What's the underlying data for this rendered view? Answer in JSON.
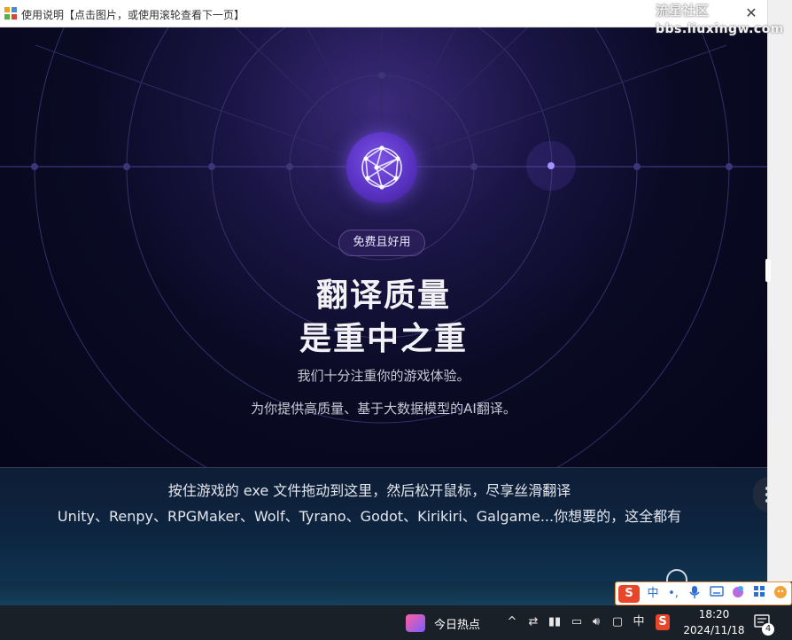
{
  "window": {
    "title": "使用说明【点击图片，或使用滚轮查看下一页】",
    "close_label": "✕"
  },
  "watermark": {
    "line1": "流星社区",
    "line2": "bbs.liuxingw.com"
  },
  "hero": {
    "badge": "免费且好用",
    "headline_1": "翻译质量",
    "headline_2": "是重中之重",
    "sub_1": "我们十分注重你的游戏体验。",
    "sub_2": "为你提供高质量、基于大数据模型的AI翻译。"
  },
  "dropzone": {
    "instruction": "按住游戏的 exe 文件拖动到这里，然后松开鼠标，尽享丝滑翻译",
    "engines": "Unity、Renpy、RPGMaker、Wolf、Tyrano、Godot、Kirikiri、Galgame...你想要的，这全都有"
  },
  "ime": {
    "logo": "S",
    "mode": "中",
    "punct": "•,",
    "icons": [
      "mic-icon",
      "keyboard-icon",
      "skin-icon",
      "apps-icon",
      "avatar-icon"
    ]
  },
  "taskbar": {
    "news_label": "今日热点",
    "tray_chevron": "^",
    "tray_ime": "中",
    "tray_s": "S",
    "time": "18:20",
    "date": "2024/11/18",
    "notification_count": "4"
  },
  "colors": {
    "accent": "#6c45d8",
    "hero_bg": "#07081a",
    "dropzone_bg": "#0d2540",
    "ime_border": "#e58a3c",
    "sogou_red": "#e8462b"
  }
}
